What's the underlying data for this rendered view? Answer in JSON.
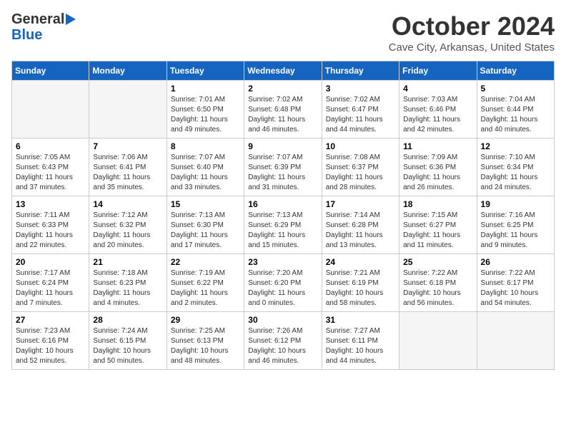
{
  "header": {
    "logo_line1": "General",
    "logo_line2": "Blue",
    "month": "October 2024",
    "location": "Cave City, Arkansas, United States"
  },
  "weekdays": [
    "Sunday",
    "Monday",
    "Tuesday",
    "Wednesday",
    "Thursday",
    "Friday",
    "Saturday"
  ],
  "weeks": [
    [
      {
        "day": "",
        "info": ""
      },
      {
        "day": "",
        "info": ""
      },
      {
        "day": "1",
        "info": "Sunrise: 7:01 AM\nSunset: 6:50 PM\nDaylight: 11 hours and 49 minutes."
      },
      {
        "day": "2",
        "info": "Sunrise: 7:02 AM\nSunset: 6:48 PM\nDaylight: 11 hours and 46 minutes."
      },
      {
        "day": "3",
        "info": "Sunrise: 7:02 AM\nSunset: 6:47 PM\nDaylight: 11 hours and 44 minutes."
      },
      {
        "day": "4",
        "info": "Sunrise: 7:03 AM\nSunset: 6:46 PM\nDaylight: 11 hours and 42 minutes."
      },
      {
        "day": "5",
        "info": "Sunrise: 7:04 AM\nSunset: 6:44 PM\nDaylight: 11 hours and 40 minutes."
      }
    ],
    [
      {
        "day": "6",
        "info": "Sunrise: 7:05 AM\nSunset: 6:43 PM\nDaylight: 11 hours and 37 minutes."
      },
      {
        "day": "7",
        "info": "Sunrise: 7:06 AM\nSunset: 6:41 PM\nDaylight: 11 hours and 35 minutes."
      },
      {
        "day": "8",
        "info": "Sunrise: 7:07 AM\nSunset: 6:40 PM\nDaylight: 11 hours and 33 minutes."
      },
      {
        "day": "9",
        "info": "Sunrise: 7:07 AM\nSunset: 6:39 PM\nDaylight: 11 hours and 31 minutes."
      },
      {
        "day": "10",
        "info": "Sunrise: 7:08 AM\nSunset: 6:37 PM\nDaylight: 11 hours and 28 minutes."
      },
      {
        "day": "11",
        "info": "Sunrise: 7:09 AM\nSunset: 6:36 PM\nDaylight: 11 hours and 26 minutes."
      },
      {
        "day": "12",
        "info": "Sunrise: 7:10 AM\nSunset: 6:34 PM\nDaylight: 11 hours and 24 minutes."
      }
    ],
    [
      {
        "day": "13",
        "info": "Sunrise: 7:11 AM\nSunset: 6:33 PM\nDaylight: 11 hours and 22 minutes."
      },
      {
        "day": "14",
        "info": "Sunrise: 7:12 AM\nSunset: 6:32 PM\nDaylight: 11 hours and 20 minutes."
      },
      {
        "day": "15",
        "info": "Sunrise: 7:13 AM\nSunset: 6:30 PM\nDaylight: 11 hours and 17 minutes."
      },
      {
        "day": "16",
        "info": "Sunrise: 7:13 AM\nSunset: 6:29 PM\nDaylight: 11 hours and 15 minutes."
      },
      {
        "day": "17",
        "info": "Sunrise: 7:14 AM\nSunset: 6:28 PM\nDaylight: 11 hours and 13 minutes."
      },
      {
        "day": "18",
        "info": "Sunrise: 7:15 AM\nSunset: 6:27 PM\nDaylight: 11 hours and 11 minutes."
      },
      {
        "day": "19",
        "info": "Sunrise: 7:16 AM\nSunset: 6:25 PM\nDaylight: 11 hours and 9 minutes."
      }
    ],
    [
      {
        "day": "20",
        "info": "Sunrise: 7:17 AM\nSunset: 6:24 PM\nDaylight: 11 hours and 7 minutes."
      },
      {
        "day": "21",
        "info": "Sunrise: 7:18 AM\nSunset: 6:23 PM\nDaylight: 11 hours and 4 minutes."
      },
      {
        "day": "22",
        "info": "Sunrise: 7:19 AM\nSunset: 6:22 PM\nDaylight: 11 hours and 2 minutes."
      },
      {
        "day": "23",
        "info": "Sunrise: 7:20 AM\nSunset: 6:20 PM\nDaylight: 11 hours and 0 minutes."
      },
      {
        "day": "24",
        "info": "Sunrise: 7:21 AM\nSunset: 6:19 PM\nDaylight: 10 hours and 58 minutes."
      },
      {
        "day": "25",
        "info": "Sunrise: 7:22 AM\nSunset: 6:18 PM\nDaylight: 10 hours and 56 minutes."
      },
      {
        "day": "26",
        "info": "Sunrise: 7:22 AM\nSunset: 6:17 PM\nDaylight: 10 hours and 54 minutes."
      }
    ],
    [
      {
        "day": "27",
        "info": "Sunrise: 7:23 AM\nSunset: 6:16 PM\nDaylight: 10 hours and 52 minutes."
      },
      {
        "day": "28",
        "info": "Sunrise: 7:24 AM\nSunset: 6:15 PM\nDaylight: 10 hours and 50 minutes."
      },
      {
        "day": "29",
        "info": "Sunrise: 7:25 AM\nSunset: 6:13 PM\nDaylight: 10 hours and 48 minutes."
      },
      {
        "day": "30",
        "info": "Sunrise: 7:26 AM\nSunset: 6:12 PM\nDaylight: 10 hours and 46 minutes."
      },
      {
        "day": "31",
        "info": "Sunrise: 7:27 AM\nSunset: 6:11 PM\nDaylight: 10 hours and 44 minutes."
      },
      {
        "day": "",
        "info": ""
      },
      {
        "day": "",
        "info": ""
      }
    ]
  ]
}
